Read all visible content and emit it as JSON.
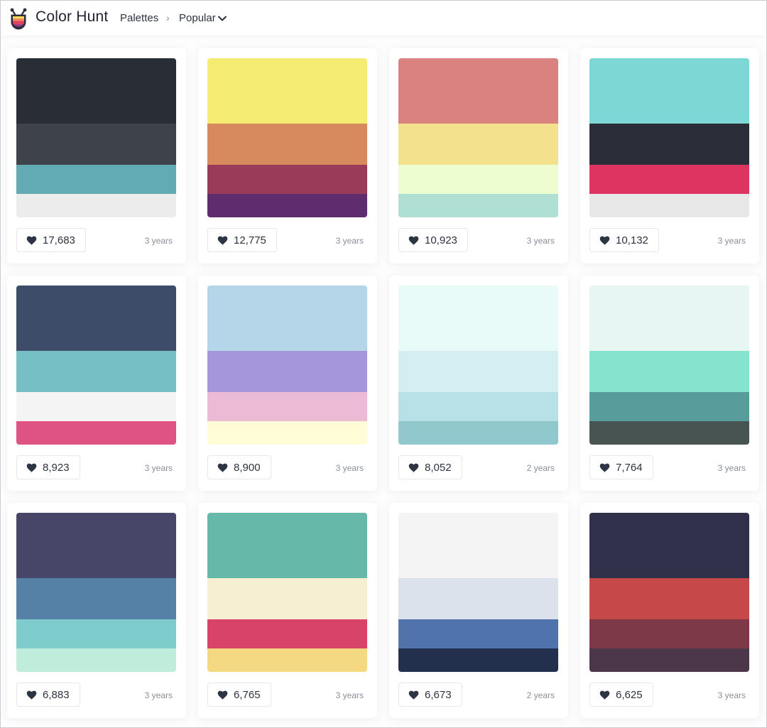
{
  "app": {
    "brand": "Color Hunt",
    "breadcrumb": {
      "root": "Palettes",
      "separator": "›",
      "current": "Popular"
    }
  },
  "palettes": [
    {
      "colors": [
        "#292d36",
        "#3d424b",
        "#62abb4",
        "#ececec"
      ],
      "likes": "17,683",
      "age": "3 years"
    },
    {
      "colors": [
        "#f5ec73",
        "#d88a5f",
        "#9b3b5a",
        "#5f2d6e"
      ],
      "likes": "12,775",
      "age": "3 years"
    },
    {
      "colors": [
        "#d9827f",
        "#f4e18d",
        "#eefdd0",
        "#afe0d3"
      ],
      "likes": "10,923",
      "age": "3 years"
    },
    {
      "colors": [
        "#7dd8d5",
        "#2b2e38",
        "#de3462",
        "#e7e7e7"
      ],
      "likes": "10,132",
      "age": "3 years"
    },
    {
      "colors": [
        "#3d4d69",
        "#76bfc5",
        "#f4f4f4",
        "#df5284"
      ],
      "likes": "8,923",
      "age": "3 years"
    },
    {
      "colors": [
        "#b5d5e8",
        "#a496d9",
        "#ebbad5",
        "#fffcd6"
      ],
      "likes": "8,900",
      "age": "3 years"
    },
    {
      "colors": [
        "#e8fbf9",
        "#d4eef2",
        "#b7e1e7",
        "#91c8cd"
      ],
      "likes": "8,052",
      "age": "2 years"
    },
    {
      "colors": [
        "#e7f6f2",
        "#86e3cd",
        "#599c9c",
        "#485451"
      ],
      "likes": "7,764",
      "age": "3 years"
    },
    {
      "colors": [
        "#474669",
        "#5681a6",
        "#7fcccc",
        "#c0ecdc"
      ],
      "likes": "6,883",
      "age": "3 years"
    },
    {
      "colors": [
        "#66b8a8",
        "#f6efd2",
        "#d74369",
        "#f4d982"
      ],
      "likes": "6,765",
      "age": "3 years"
    },
    {
      "colors": [
        "#f4f4f4",
        "#dbe2ec",
        "#5073ad",
        "#23304d"
      ],
      "likes": "6,673",
      "age": "2 years"
    },
    {
      "colors": [
        "#30304b",
        "#c74848",
        "#7e3949",
        "#4c364a"
      ],
      "likes": "6,625",
      "age": "3 years"
    }
  ],
  "icons": {
    "logo": "color-hunt-logo",
    "like": "heart-icon",
    "dropdown": "chevron-down-icon"
  }
}
